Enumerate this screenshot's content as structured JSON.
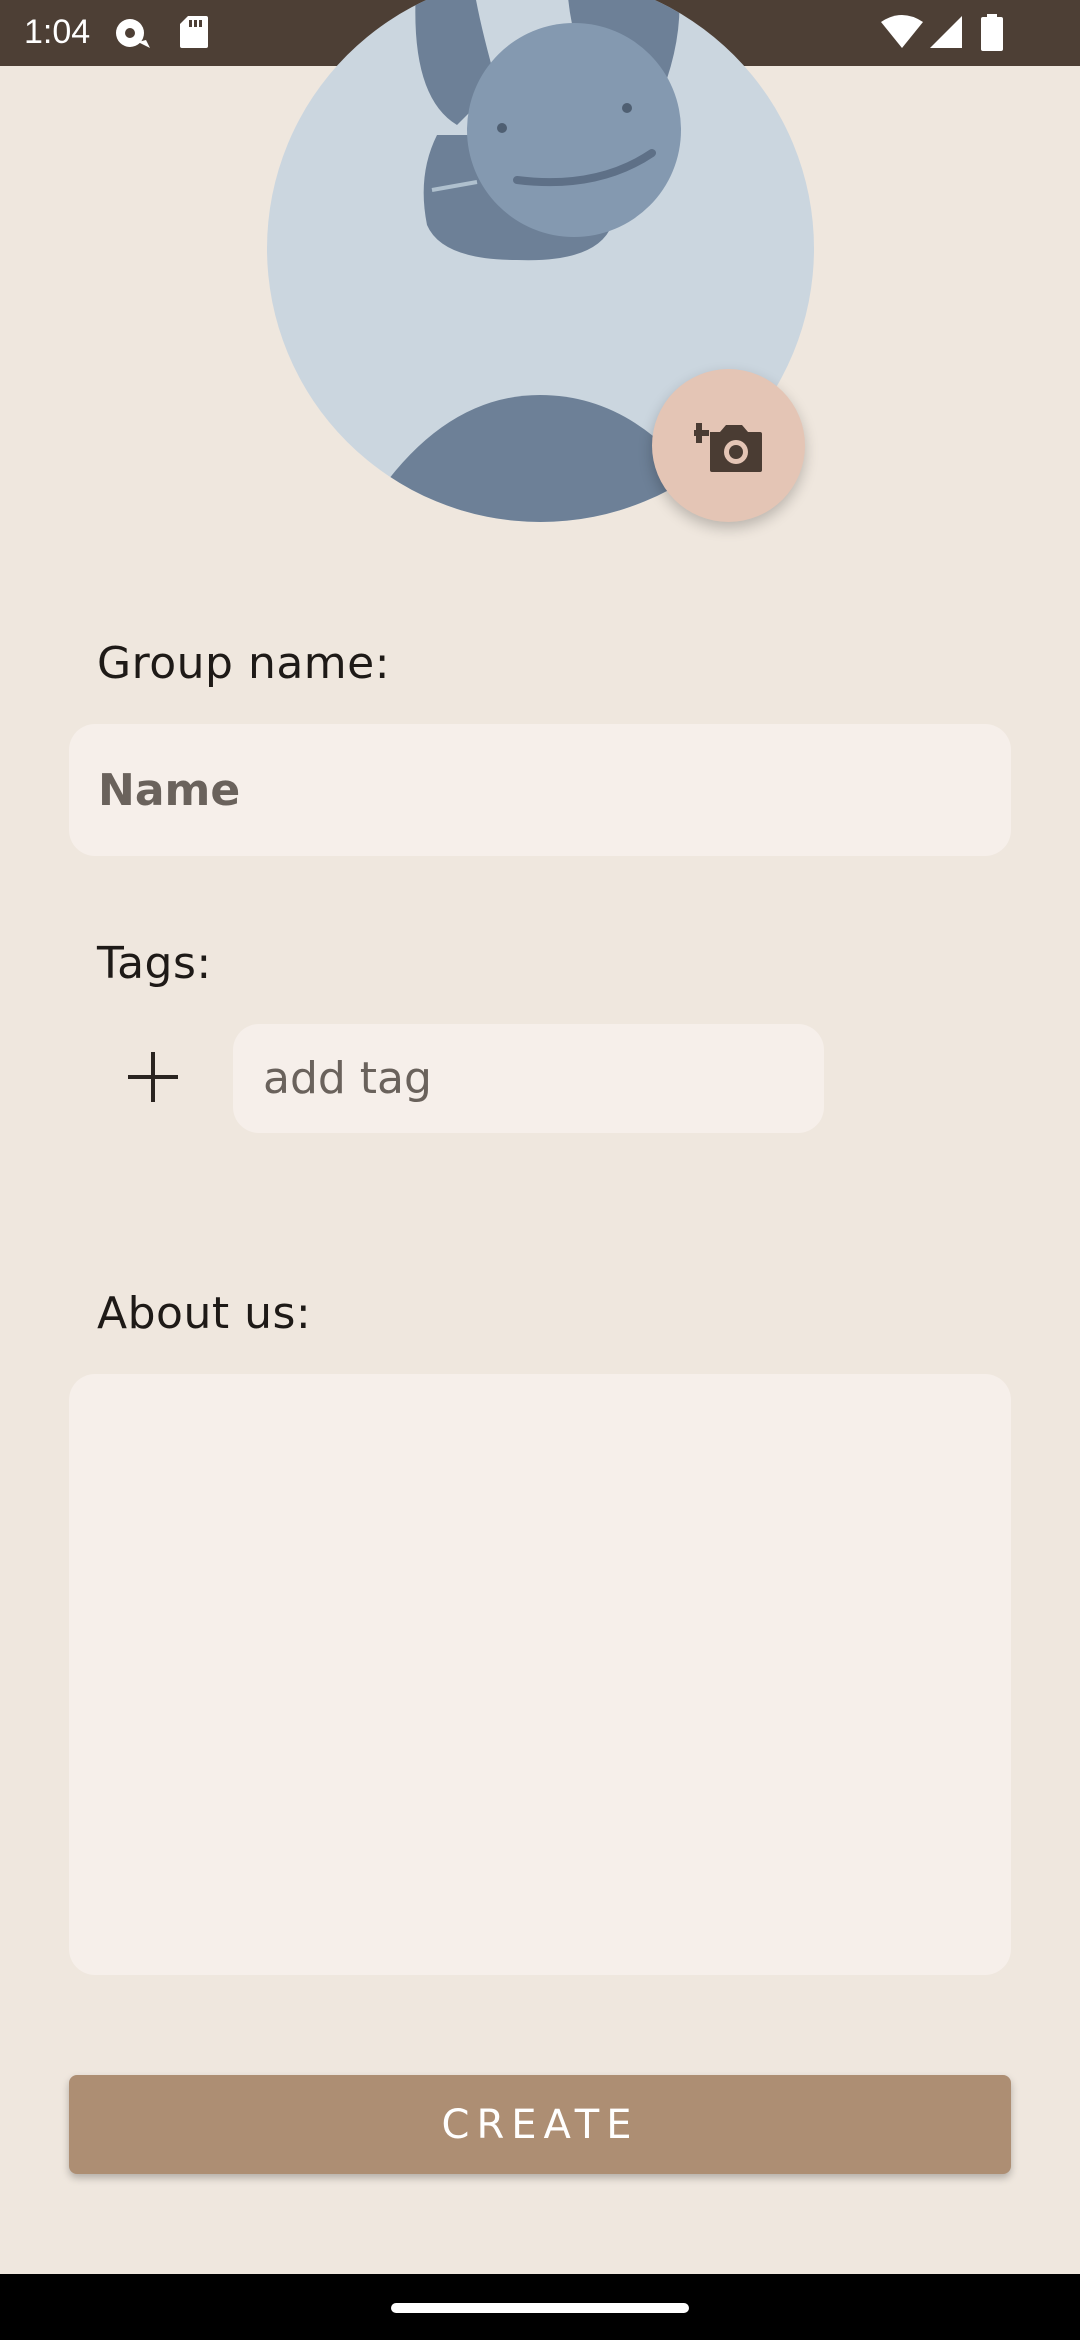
{
  "status_bar": {
    "time": "1:04",
    "icons": [
      "cast-icon",
      "sd-card-icon",
      "wifi-icon",
      "signal-icon",
      "battery-icon"
    ]
  },
  "avatar": {
    "icon": "group-avatar-placeholder",
    "camera_button_icon": "add-photo-camera-icon"
  },
  "form": {
    "group_name_label": "Group name:",
    "name_placeholder": "Name",
    "tags_label": "Tags:",
    "add_tag_icon": "plus-icon",
    "tag_placeholder": "add tag",
    "about_label": "About us:",
    "about_value": ""
  },
  "actions": {
    "create_label": "CREATE"
  },
  "colors": {
    "background": "#EFE7DE",
    "status_bar": "#4D3F35",
    "field_bg": "#F6EFEA",
    "accent": "#AD8E73",
    "fab": "#E4C5B5"
  }
}
